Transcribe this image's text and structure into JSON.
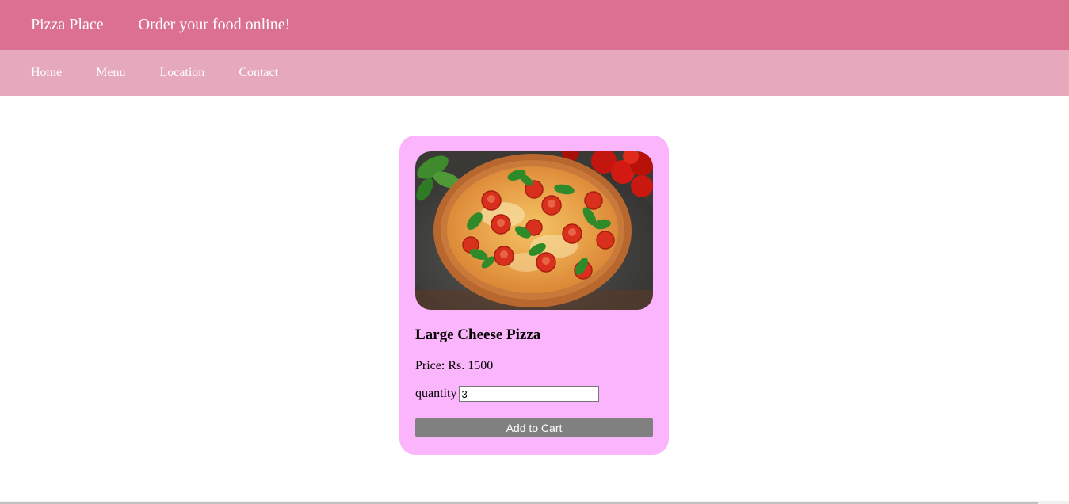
{
  "header": {
    "brand": "Pizza Place",
    "tagline": "Order your food online!"
  },
  "nav": {
    "items": [
      "Home",
      "Menu",
      "Location",
      "Contact"
    ]
  },
  "product": {
    "image_icon": "pizza-photo",
    "name": "Large Cheese Pizza",
    "price": "Price: Rs. 1500",
    "quantity_label": "quantity",
    "quantity_value": "3",
    "add_button": "Add to Cart"
  },
  "colors": {
    "header": "#dc7091",
    "nav": "#e6a8bd",
    "card": "#fbb5fd",
    "button": "#808080"
  }
}
